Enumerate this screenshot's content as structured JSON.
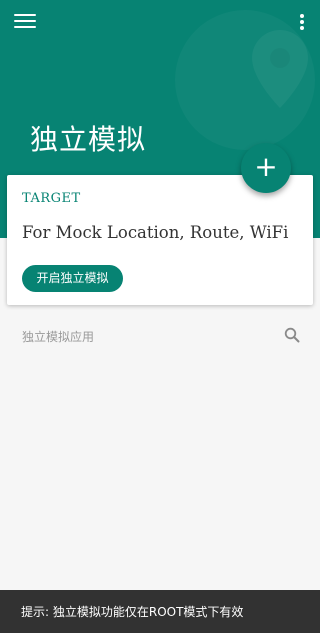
{
  "header": {
    "title": "独立模拟",
    "menu_icon": "hamburger-menu-icon",
    "more_icon": "more-vert-icon",
    "background_decoration": "map-pin-decoration",
    "accent_color": "#078373"
  },
  "fab": {
    "label": "+",
    "icon": "add-icon"
  },
  "card": {
    "label": "TARGET",
    "description": "For Mock Location, Route, WiFi",
    "button_label": "开启独立模拟"
  },
  "search": {
    "placeholder": "独立模拟应用",
    "icon": "search-icon"
  },
  "toast": {
    "text": "提示: 独立模拟功能仅在ROOT模式下有效"
  }
}
